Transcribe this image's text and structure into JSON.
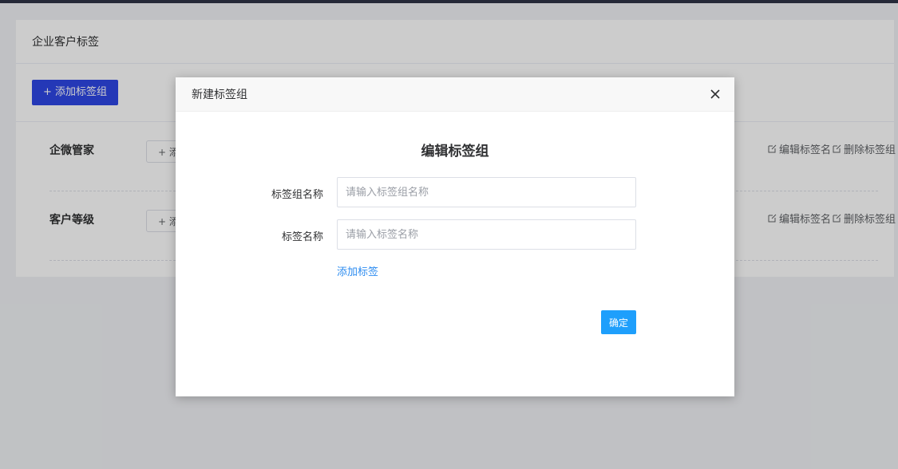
{
  "page": {
    "card_title": "企业客户标签",
    "add_group_button": "+ 添加标签组",
    "groups": [
      {
        "name": "企微管家",
        "add_tag": "+ 添",
        "edit": "编辑标签名",
        "delete": "删除标签组"
      },
      {
        "name": "客户等级",
        "add_tag": "+ 添",
        "edit": "编辑标签名",
        "delete": "删除标签组"
      }
    ]
  },
  "dialog": {
    "header_title": "新建标签组",
    "title": "编辑标签组",
    "group_name_label": "标签组名称",
    "group_name_placeholder": "请输入标签组名称",
    "group_name_value": "",
    "tag_name_label": "标签名称",
    "tag_name_placeholder": "请输入标签名称",
    "tag_name_value": "",
    "add_tag_link": "添加标签",
    "confirm_button": "确定",
    "close_icon": "close-icon"
  },
  "colors": {
    "primary_blue": "#2d46e5",
    "link_blue": "#2d8cf0",
    "confirm_blue": "#1e9ffc",
    "topbar": "#2f3447"
  }
}
